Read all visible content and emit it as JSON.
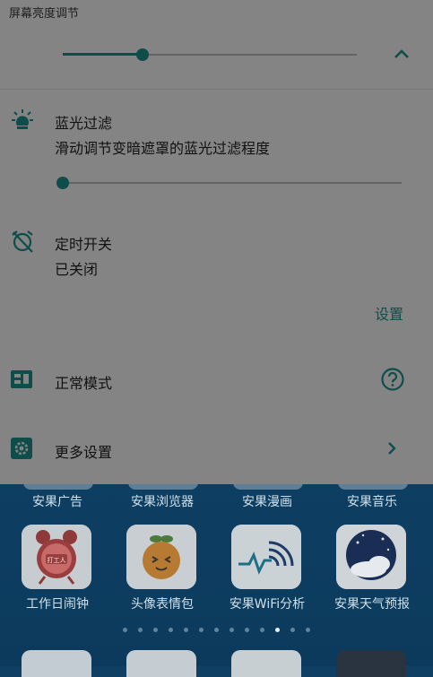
{
  "panel": {
    "section_title": "屏幕亮度调节",
    "brightness_level": 0.27,
    "blue_light": {
      "title": "蓝光过滤",
      "description": "滑动调节变暗遮罩的蓝光过滤程度",
      "level": 0.0
    },
    "timer": {
      "title": "定时开关",
      "status": "已关闭",
      "settings_link": "设置"
    },
    "mode": {
      "label": "正常模式"
    },
    "more": {
      "label": "更多设置"
    },
    "accent_color": "#0f4d4a",
    "background_color": "#848484"
  },
  "home": {
    "top_row_labels": [
      "安果广告",
      "安果浏览器",
      "安果漫画",
      "安果音乐"
    ],
    "apps": [
      {
        "label": "工作日闹钟",
        "icon": "alarm-clock-icon",
        "badge": "打工人"
      },
      {
        "label": "头像表情包",
        "icon": "orange-emoji-icon"
      },
      {
        "label": "安果WiFi分析",
        "icon": "wifi-analysis-icon"
      },
      {
        "label": "安果天气预报",
        "icon": "weather-moon-cloud-icon"
      }
    ],
    "page_count": 13,
    "active_page": 10
  }
}
